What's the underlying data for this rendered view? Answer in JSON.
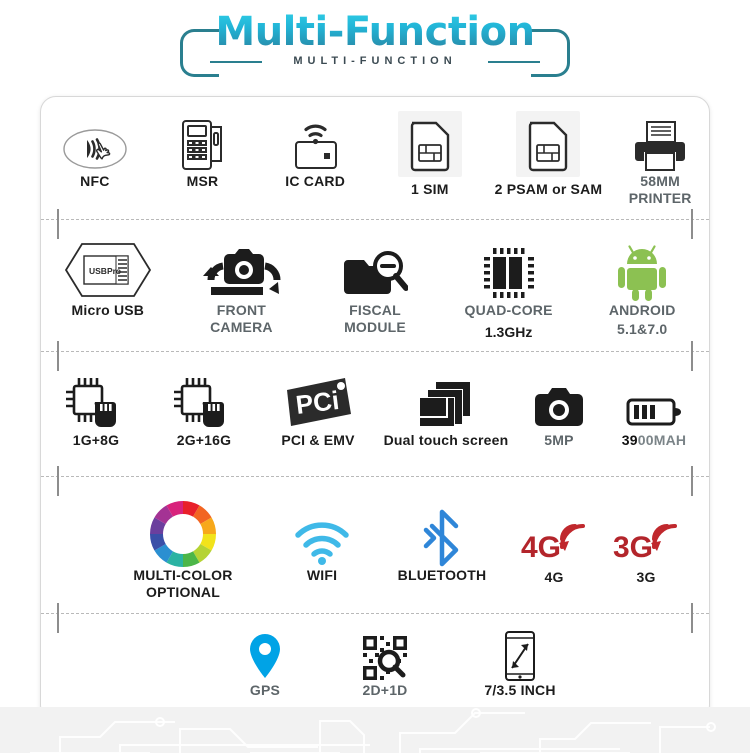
{
  "header": {
    "title": "Multi-Function",
    "subtitle": "MULTI-FUNCTION",
    "accent_color": "#26a8c8",
    "bracket_color": "#2a7f8f"
  },
  "colors": {
    "icon_dark": "#1c1c1c",
    "icon_gray": "#5d6569",
    "android_green": "#8cc152",
    "wifi_blue": "#3fb9e8",
    "bluetooth_blue": "#2f86d8",
    "gps_blue": "#00a3e6",
    "signal_red": "#c0282d",
    "card_border": "#d8d8d8",
    "separator": "#b9b9b9"
  },
  "rows": [
    {
      "name": "row-payment",
      "items": [
        {
          "icon": "nfc-icon",
          "label": "NFC",
          "style": "dark"
        },
        {
          "icon": "msr-terminal-icon",
          "label": "MSR",
          "style": "dark"
        },
        {
          "icon": "ic-card-icon",
          "label": "IC CARD",
          "style": "dark"
        },
        {
          "icon": "sim-card-icon",
          "label": "1  SIM",
          "style": "dark"
        },
        {
          "icon": "psam-card-icon",
          "label": "2 PSAM or SAM",
          "style": "dark"
        },
        {
          "icon": "printer-icon",
          "label": "58MM\nPRINTER",
          "style": "gray"
        }
      ]
    },
    {
      "name": "row-hardware",
      "items": [
        {
          "icon": "micro-usb-icon",
          "label": "Micro USB",
          "style": "dark",
          "badge": "USBPro"
        },
        {
          "icon": "front-camera-icon",
          "label": "FRONT\nCAMERA",
          "style": "gray"
        },
        {
          "icon": "fiscal-module-icon",
          "label": "FISCAL\nMODULE",
          "style": "gray"
        },
        {
          "icon": "quad-core-icon",
          "label": "QUAD-CORE",
          "style": "gray",
          "sublabel": "1.3GHz"
        },
        {
          "icon": "android-icon",
          "label": "ANDROID",
          "style": "gray",
          "sublabel": "5.1&7.0"
        }
      ]
    },
    {
      "name": "row-specs",
      "items": [
        {
          "icon": "memory-chip-1g-icon",
          "label": "1G+8G",
          "style": "dark"
        },
        {
          "icon": "memory-chip-2g-icon",
          "label": "2G+16G",
          "style": "dark"
        },
        {
          "icon": "pci-logo-icon",
          "label": "PCI & EMV",
          "style": "dark"
        },
        {
          "icon": "dual-screen-icon",
          "label": "Dual touch screen",
          "style": "dark"
        },
        {
          "icon": "camera-icon",
          "label": "5MP",
          "style": "gray"
        },
        {
          "icon": "battery-icon",
          "label": "3900MAH",
          "style": "split",
          "label_bold": "39",
          "label_rest": "00MAH"
        }
      ]
    },
    {
      "name": "row-connectivity",
      "items": [
        {
          "icon": "color-wheel-icon",
          "label": "MULTI-COLOR\nOPTIONAL",
          "style": "dark"
        },
        {
          "icon": "wifi-icon",
          "label": "WIFI",
          "style": "dark"
        },
        {
          "icon": "bluetooth-icon",
          "label": "BLUETOOTH",
          "style": "dark"
        },
        {
          "icon": "signal-4g-icon",
          "label": "4G",
          "style": "dark"
        },
        {
          "icon": "signal-3g-icon",
          "label": "3G",
          "style": "dark"
        }
      ]
    },
    {
      "name": "row-extras",
      "items": [
        {
          "icon": "gps-pin-icon",
          "label": "GPS",
          "style": "gray"
        },
        {
          "icon": "qr-scanner-icon",
          "label": "2D+1D",
          "style": "gray"
        },
        {
          "icon": "screen-size-icon",
          "label": "7/3.5 INCH",
          "style": "dark"
        }
      ]
    }
  ]
}
